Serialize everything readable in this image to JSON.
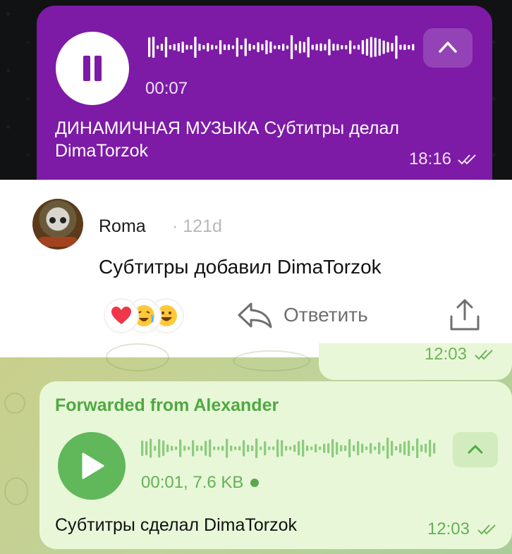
{
  "top_message": {
    "duration": "00:07",
    "caption": "ДИНАМИЧНАЯ МУЗЫКА Субтитры делал DimaTorzok",
    "time": "18:16"
  },
  "comment": {
    "username": "Roma",
    "age": "· 121d",
    "text": "Субтитры добавил DimaTorzok",
    "reply_label": "Ответить",
    "reactions": [
      "heart",
      "crying-laughing-emoji",
      "grinning-emoji"
    ]
  },
  "previous_message": {
    "time": "12:03"
  },
  "forwarded_message": {
    "forwarded_from": "Forwarded from Alexander",
    "info": "00:01, 7.6 KB",
    "caption": "Субтитры сделал DimaTorzok",
    "time": "12:03"
  },
  "colors": {
    "purple_bubble": "#7d1aa6",
    "green_bubble": "#e9f7d9",
    "green_accent": "#60b85a"
  }
}
